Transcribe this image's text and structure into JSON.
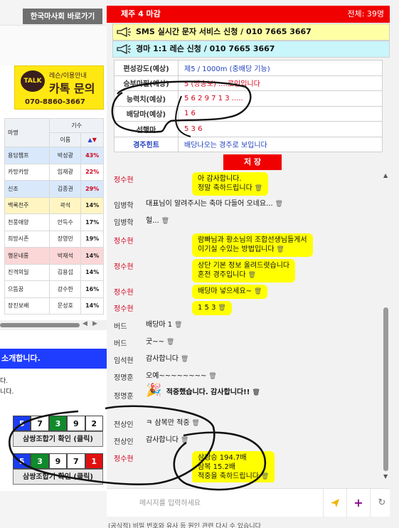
{
  "left": {
    "shortcut_label": "한국마사회 바로가기",
    "talk_banner": {
      "bubble": "TALK",
      "sub": "레슨/이용안내",
      "title": "카톡 문의",
      "phone": "070-8860-3667"
    },
    "jockey_table": {
      "header_horse": "마명",
      "header_jockey_group": "기수",
      "header_name": "이름",
      "rows": [
        {
          "horse": "용담챔프",
          "jockey": "박성광",
          "rate": "43%",
          "rate_red": true,
          "style": "blue"
        },
        {
          "horse": "카망카망",
          "jockey": "임재광",
          "rate": "22%",
          "rate_red": true,
          "style": "plain"
        },
        {
          "horse": "신조",
          "jockey": "김종권",
          "rate": "29%",
          "rate_red": true,
          "style": "blue"
        },
        {
          "horse": "백록천주",
          "jockey": "곽석",
          "rate": "14%",
          "rate_red": false,
          "style": "yellow"
        },
        {
          "horse": "천풍애양",
          "jockey": "안득수",
          "rate": "17%",
          "rate_red": false,
          "style": "plain"
        },
        {
          "horse": "희망시존",
          "jockey": "장영민",
          "rate": "19%",
          "rate_red": false,
          "style": "plain"
        },
        {
          "horse": "행운네롱",
          "jockey": "박재석",
          "rate": "14%",
          "rate_red": false,
          "style": "pink"
        },
        {
          "horse": "진격의일",
          "jockey": "김용섭",
          "rate": "14%",
          "rate_red": false,
          "style": "plain"
        },
        {
          "horse": "으뜸꿈",
          "jockey": "강수한",
          "rate": "16%",
          "rate_red": false,
          "style": "plain"
        },
        {
          "horse": "장진보배",
          "jockey": "문성호",
          "rate": "14%",
          "rate_red": false,
          "style": "plain"
        }
      ]
    },
    "intro_bar": "소개합니다.",
    "intro_line1": "다.",
    "intro_line2": "니다.",
    "combo1": {
      "numbers": [
        "5",
        "7",
        "3",
        "9",
        "2"
      ],
      "colors": [
        "blue",
        "white",
        "green",
        "white",
        "white"
      ],
      "button": "삼쌍조합기 확인 (클릭)"
    },
    "combo2": {
      "numbers": [
        "5",
        "3",
        "9",
        "7",
        "1"
      ],
      "colors": [
        "blue",
        "green",
        "white",
        "white",
        "red"
      ],
      "button": "삼쌍조합기 확인 (클릭)"
    }
  },
  "right": {
    "race_title": "제주 4 마감",
    "total_label": "전체: 39명",
    "notice_sms": "SMS 실시간 문자 서비스 신청 / 010 7665 3667",
    "notice_lesson": "경마 1:1 레슨 신청 / 010 7665 3667",
    "info": [
      {
        "key": "편성강도(예상)",
        "value": "제5 / 1000m (중배당 기능)",
        "value_color": "blue"
      },
      {
        "key": "승부마필(예상)",
        "value": "5 (방송보) ....로인입니다",
        "value_color": "red"
      },
      {
        "key": "능력치(예상)",
        "value": "5 6 2 9 7 1 3 .....",
        "value_color": "red"
      },
      {
        "key": "배당마(예상)",
        "value": "1 6",
        "value_color": "red"
      },
      {
        "key": "선행마",
        "value": "5 3 6",
        "value_color": "red"
      },
      {
        "key": "경주힌트",
        "value": "배당나오는 경주로 보입니다",
        "value_color": "blue",
        "key_blue": true
      }
    ],
    "save_label": "저 장",
    "messages": [
      {
        "nick": "정수현",
        "nick_red": true,
        "text": "아 감사합니다.\n정말 축하드립니다",
        "bubble": true
      },
      {
        "nick": "임병학",
        "nick_red": false,
        "text": "대표님이 알려주시는 축마 다들어 오네요...",
        "bubble": false
      },
      {
        "nick": "임병학",
        "nick_red": false,
        "text": "헐...",
        "bubble": false
      },
      {
        "nick": "정수현",
        "nick_red": true,
        "text": "람빠님과 황소님의 조합선생님들게서\n이기실 수있는 방법입니다",
        "bubble": true
      },
      {
        "nick": "정수현",
        "nick_red": true,
        "text": "상단 기본 정보 올려드렷습니다\n혼전 경주입니다",
        "bubble": true
      },
      {
        "nick": "정수현",
        "nick_red": true,
        "text": "배당마 넣으세요~",
        "bubble": true
      },
      {
        "nick": "정수현",
        "nick_red": true,
        "text": "1 5 3",
        "bubble": true
      },
      {
        "nick": "버드",
        "nick_red": false,
        "text": "배당마 1",
        "bubble": false
      },
      {
        "nick": "버드",
        "nick_red": false,
        "text": "굿~~",
        "bubble": false
      },
      {
        "nick": "임석현",
        "nick_red": false,
        "text": "감사합니다",
        "bubble": false
      },
      {
        "nick": "정명훈",
        "nick_red": false,
        "text": "오예~~~~~~~~",
        "bubble": false
      },
      {
        "nick": "정명훈",
        "nick_red": false,
        "text": "적중했습니다. 감사합니다!!",
        "bubble": false,
        "emoji": true
      },
      {
        "nick": "전상인",
        "nick_red": false,
        "text": "ㅋ 삼복만 적중",
        "bubble": false
      },
      {
        "nick": "전상인",
        "nick_red": false,
        "text": "감사합니다",
        "bubble": false
      },
      {
        "nick": "정수현",
        "nick_red": true,
        "text": "삼쌍승 194.7배\n삼복 15.2배\n적중을 축하드립니다",
        "bubble": true
      }
    ],
    "input_placeholder": "메시지를 입력하세요",
    "bottom_note": "(공식적) 비밀 번호와 유사 등 원인 관련 다시 수 있습니다"
  },
  "colors": {
    "race_red": "#f00000",
    "notice_yellow": "#ffffa6",
    "notice_cyan": "#c8f6fa",
    "bubble_yellow": "#ffff00",
    "intro_blue": "#1f3dff",
    "nick_red": "#d4001a"
  },
  "icons": [
    "megaphone-icon",
    "send-icon",
    "plus-icon",
    "refresh-icon",
    "trash-icon",
    "party-popper-icon",
    "scroll-arrow-icon"
  ]
}
